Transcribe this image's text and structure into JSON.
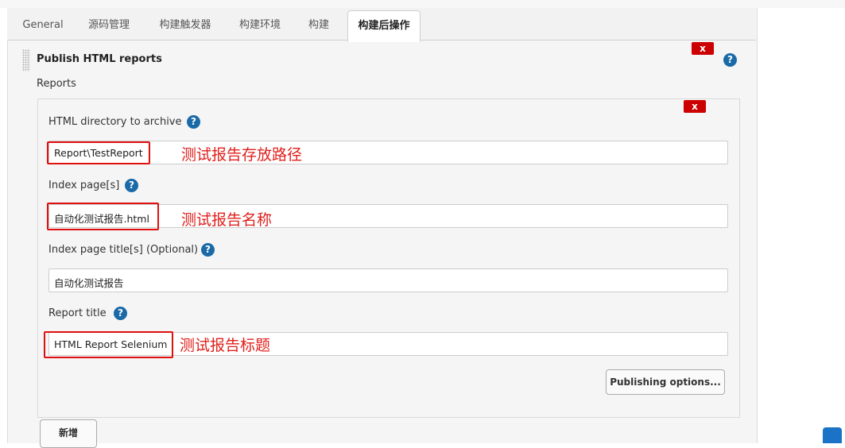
{
  "tabs": [
    {
      "label": "General"
    },
    {
      "label": "源码管理"
    },
    {
      "label": "构建触发器"
    },
    {
      "label": "构建环境"
    },
    {
      "label": "构建"
    },
    {
      "label": "构建后操作"
    }
  ],
  "section": {
    "title": "Publish HTML reports",
    "reports_label": "Reports",
    "delete_label": "x",
    "help_glyph": "?"
  },
  "report": {
    "delete_label": "x",
    "fields": [
      {
        "label": "HTML directory to archive",
        "value": "Report\\TestReport",
        "annotation": "测试报告存放路径"
      },
      {
        "label": "Index page[s]",
        "value": "自动化测试报告.html",
        "annotation": "测试报告名称"
      },
      {
        "label": "Index page title[s] (Optional)",
        "value": "自动化测试报告",
        "annotation": ""
      },
      {
        "label": "Report title",
        "value": "HTML Report Selenium",
        "annotation": "测试报告标题"
      }
    ],
    "publishing_options_label": "Publishing options..."
  },
  "add_button_label": "新增",
  "colors": {
    "accent_red": "#cc0000",
    "help_blue": "#1a6aa8",
    "annotation_red": "#e0201c"
  }
}
